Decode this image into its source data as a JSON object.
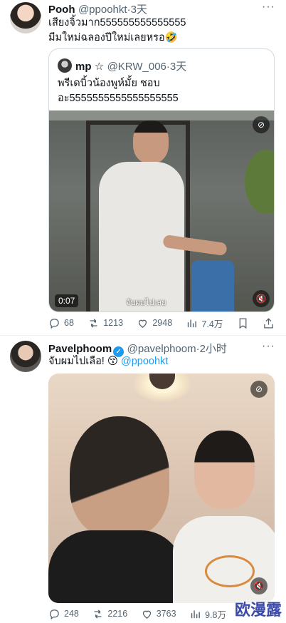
{
  "tweet1": {
    "name": "Pooh",
    "handle": "@ppoohkt",
    "sep": "·",
    "time": "3天",
    "more": "···",
    "line1": "เสียงจิ้วมาก555555555555555",
    "line2": "มีมใหม่ฉลองปีใหม่เลยหรอ🤣",
    "quote": {
      "name": "mp ☆",
      "handle": "@KRW_006",
      "time": "3天",
      "line1": "พรีเดบิ้วน้องพูห์มั้ย ชอบ",
      "line2": "อะ5555555555555555555"
    },
    "video": {
      "duration": "0:07",
      "subtitle": "จับผมไปเลย"
    },
    "stats": {
      "replies": "68",
      "retweets": "1213",
      "likes": "2948",
      "views": "7.4万"
    }
  },
  "tweet2": {
    "name": "Pavelphoom",
    "handle": "@pavelphoom",
    "sep": "·",
    "time": "2小时",
    "more": "···",
    "text": "จับผมไปเลือ! 😚",
    "mention": "@ppoohkt",
    "stats": {
      "replies": "248",
      "retweets": "2216",
      "likes": "3763",
      "views": "9.8万"
    }
  },
  "watermark": "欧漫露"
}
